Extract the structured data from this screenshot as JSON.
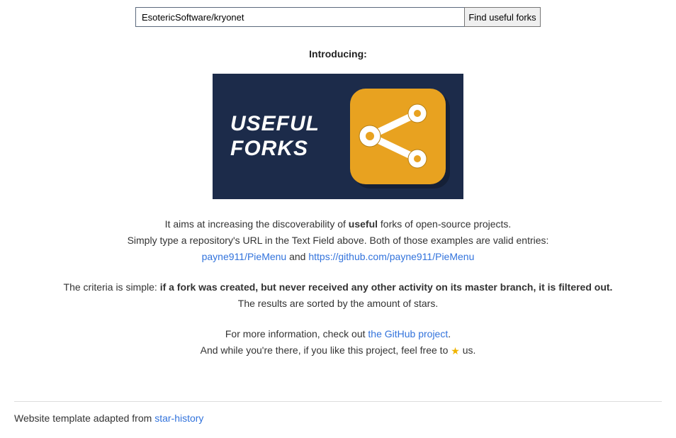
{
  "search": {
    "value": "EsotericSoftware/kryonet",
    "button_label": "Find useful forks"
  },
  "intro": {
    "heading": "Introducing:",
    "logo_line1": "USEFUL",
    "logo_line2": "FORKS"
  },
  "desc": {
    "line1_pre": "It aims at increasing the discoverability of ",
    "line1_bold": "useful",
    "line1_post": " forks of open-source projects.",
    "line2": "Simply type a repository's URL in the Text Field above. Both of those examples are valid entries:",
    "example1": "payne911/PieMenu",
    "example_sep": " and ",
    "example2": "https://github.com/payne911/PieMenu",
    "criteria_pre": "The criteria is simple: ",
    "criteria_bold": "if a fork was created, but never received any other activity on its master branch, it is filtered out.",
    "results_line": "The results are sorted by the amount of stars.",
    "more_info_pre": "For more information, check out ",
    "more_info_link": "the GitHub project",
    "more_info_post": ".",
    "star_pre": "And while you're there, if you like this project, feel free to ",
    "star_post": " us."
  },
  "footer": {
    "text": "Website template adapted from ",
    "link": "star-history"
  }
}
